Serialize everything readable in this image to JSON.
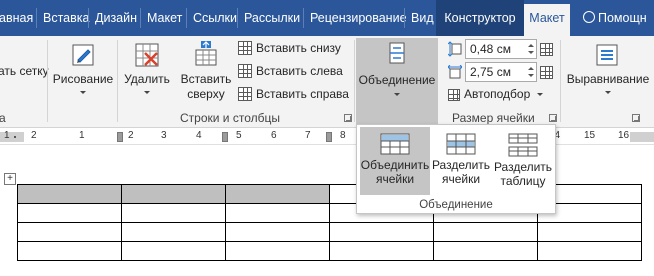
{
  "tabs": [
    {
      "label": "авная",
      "type": "normal"
    },
    {
      "label": "Вставка",
      "type": "normal"
    },
    {
      "label": "Дизайн",
      "type": "normal"
    },
    {
      "label": "Макет",
      "type": "normal"
    },
    {
      "label": "Ссылки",
      "type": "normal"
    },
    {
      "label": "Рассылки",
      "type": "normal"
    },
    {
      "label": "Рецензирование",
      "type": "normal"
    },
    {
      "label": "Вид",
      "type": "normal"
    },
    {
      "label": "Конструктор",
      "type": "context"
    },
    {
      "label": "Макет",
      "type": "active"
    }
  ],
  "help": {
    "label": "Помощн",
    "icon": "lightbulb-icon"
  },
  "ribbon": {
    "draw_grid_label": "ать сетку",
    "draw_label": "Рисование",
    "delete_label": "Удалить",
    "insert_above_label_1": "Вставить",
    "insert_above_label_2": "сверху",
    "insert_below_label": "Вставить снизу",
    "insert_left_label": "Вставить слева",
    "insert_right_label": "Вставить справа",
    "rows_cols_group": "Строки и столбцы",
    "left_group_label": "а",
    "merge_label": "Объединение",
    "height_value": "0,48 см",
    "width_value": "2,75 см",
    "autofit_label": "Автоподбор",
    "cell_size_group": "Размер ячейки",
    "align_label": "Выравнивание"
  },
  "ruler": {
    "numbers": [
      "1",
      "2",
      "1",
      "2",
      "3",
      "4",
      "5",
      "6",
      "7",
      "8",
      "9",
      "10",
      "11",
      "12",
      "13",
      "14",
      "15",
      "16"
    ]
  },
  "merge_menu": {
    "items": [
      {
        "line1": "Объединить",
        "line2": "ячейки",
        "icon": "merge-cells-icon"
      },
      {
        "line1": "Разделить",
        "line2": "ячейки",
        "icon": "split-cells-icon"
      },
      {
        "line1": "Разделить",
        "line2": "таблицу",
        "icon": "split-table-icon"
      }
    ],
    "group_label": "Объединение"
  },
  "colors": {
    "tab_bar": "#2b579a",
    "context_tab": "#1f4378",
    "ribbon_bg": "#f3f3f3",
    "pressed": "#c5c5c5",
    "selected_cell": "#bfbfbf"
  }
}
